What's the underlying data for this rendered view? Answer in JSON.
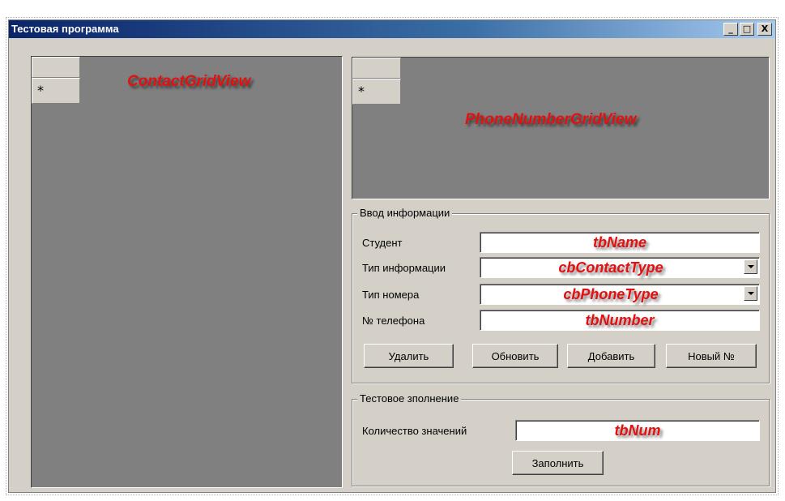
{
  "window": {
    "title": "Тестовая программа",
    "controls": {
      "minimize": "_",
      "maximize": "□",
      "close": "X"
    }
  },
  "contact_grid": {
    "caption": "ContactGridView",
    "new_row_marker": "*"
  },
  "phone_grid": {
    "caption": "PhoneNumberGridView",
    "new_row_marker": "*"
  },
  "info_group": {
    "title": "Ввод информации",
    "fields": {
      "name": {
        "label": "Студент",
        "value": "tbName"
      },
      "contact_type": {
        "label": "Тип информации",
        "value": "cbContactType"
      },
      "phone_type": {
        "label": "Тип номера",
        "value": "cbPhoneType"
      },
      "number": {
        "label": "№ телефона",
        "value": "tbNumber"
      }
    },
    "buttons": {
      "delete": "Удалить",
      "update": "Обновить",
      "add": "Добавить",
      "new_number": "Новый №"
    }
  },
  "test_group": {
    "title": "Тестовое зполнение",
    "count_label": "Количество значений",
    "count_value": "tbNum",
    "fill_button": "Заполнить"
  },
  "colors": {
    "titlebar_start": "#0a246a",
    "titlebar_end": "#a6caf0",
    "window_face": "#d4d0c8",
    "grid_background": "#808080",
    "annotation_red": "#e41010"
  }
}
